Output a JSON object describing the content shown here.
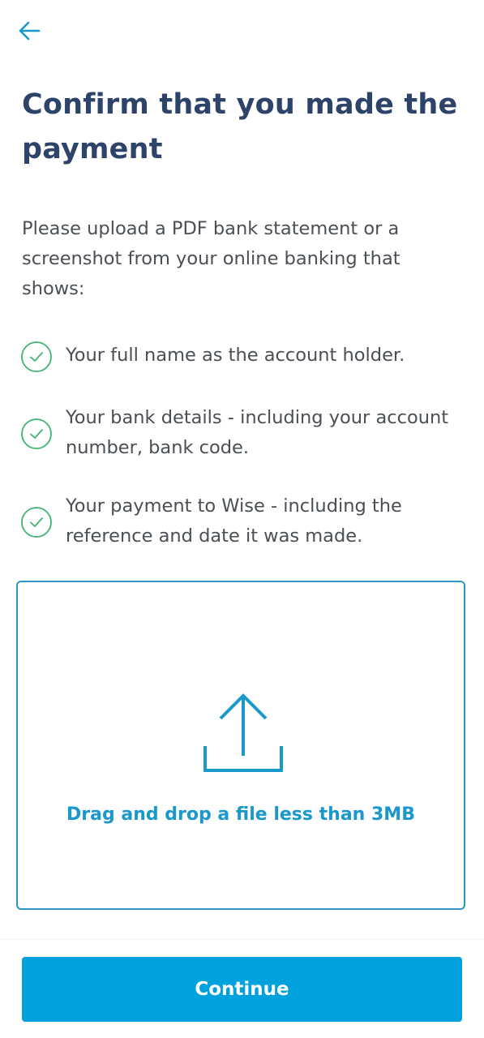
{
  "header": {
    "back_icon": "arrow-left-icon"
  },
  "title": "Confirm that you made the payment",
  "intro": "Please upload a PDF bank statement or a screenshot from your online banking that shows:",
  "checklist": [
    {
      "icon": "check-circle-icon",
      "text": "Your full name as the account holder."
    },
    {
      "icon": "check-circle-icon",
      "text": "Your bank details - including your account number, bank code."
    },
    {
      "icon": "check-circle-icon",
      "text": "Your payment to Wise - including the reference and date it was made."
    }
  ],
  "upload": {
    "icon": "upload-icon",
    "label": "Drag and drop a file less than 3MB"
  },
  "footer": {
    "continue_label": "Continue"
  },
  "colors": {
    "title": "#2e4369",
    "body_text": "#4a4f56",
    "accent": "#00a2dd",
    "check_green": "#3fb573",
    "upload_border": "#2f95c6"
  }
}
